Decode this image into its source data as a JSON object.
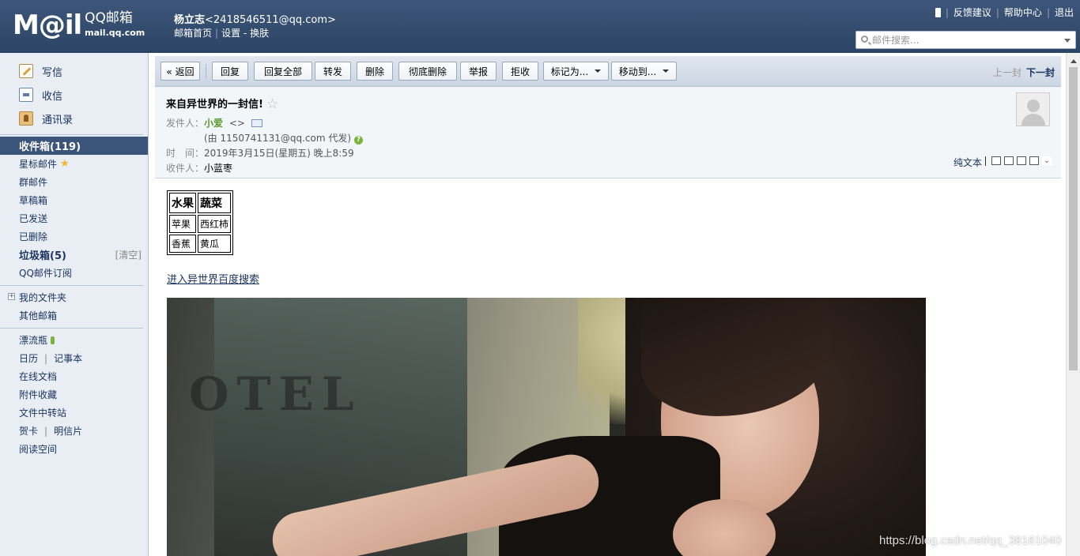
{
  "header": {
    "logo_mail": "M@il",
    "logo_qq": "QQ邮箱",
    "logo_domain": "mail.qq.com",
    "user_name": "杨立志",
    "user_email": "<2418546511@qq.com>",
    "links": {
      "home": "邮箱首页",
      "settings": "设置",
      "dash": "-",
      "skin": "换肤"
    },
    "top_right": {
      "feedback": "反馈建议",
      "help": "帮助中心",
      "logout": "退出"
    },
    "search": {
      "placeholder": "邮件搜索..."
    }
  },
  "sidebar": {
    "write": "写信",
    "receive": "收信",
    "contacts": "通讯录",
    "inbox": "收件箱(119)",
    "starred": "星标邮件",
    "group": "群邮件",
    "drafts": "草稿箱",
    "sent": "已发送",
    "deleted": "已删除",
    "spam": "垃圾箱(5)",
    "spam_clear": "[清空]",
    "subscriptions": "QQ邮件订阅",
    "my_folders": "我的文件夹",
    "other_mailboxes": "其他邮箱",
    "drift_bottle": "漂流瓶",
    "calendar": "日历",
    "notebook": "记事本",
    "online_docs": "在线文档",
    "attachments": "附件收藏",
    "file_transfer": "文件中转站",
    "greeting_card": "贺卡",
    "postcard": "明信片",
    "reading_space": "阅读空间",
    "pipe": "|"
  },
  "toolbar": {
    "back": "« 返回",
    "reply": "回复",
    "reply_all": "回复全部",
    "forward": "转发",
    "delete": "删除",
    "delete_perm": "彻底删除",
    "report": "举报",
    "reject": "拒收",
    "mark_as": "标记为...",
    "move_to": "移动到...",
    "prev": "上一封",
    "next": "下一封"
  },
  "mail": {
    "subject": "来自异世界的一封信!",
    "from_label": "发件人：",
    "from_name": "小爱",
    "from_addr": "<>",
    "via": "(由 1150741131@qq.com 代发)",
    "time_label": "时　间：",
    "time_value": "2019年3月15日(星期五) 晚上8:59",
    "to_label": "收件人：",
    "to_value": "小蓝枣",
    "plain_text": "纯文本",
    "table": {
      "headers": [
        "水果",
        "蔬菜"
      ],
      "rows": [
        [
          "苹果",
          "西红柿"
        ],
        [
          "香蕉",
          "黄瓜"
        ]
      ]
    },
    "link": "进入异世界百度搜索",
    "photo_sign": "OTEL"
  },
  "watermark": "https://blog.csdn.net/qq_38161040"
}
